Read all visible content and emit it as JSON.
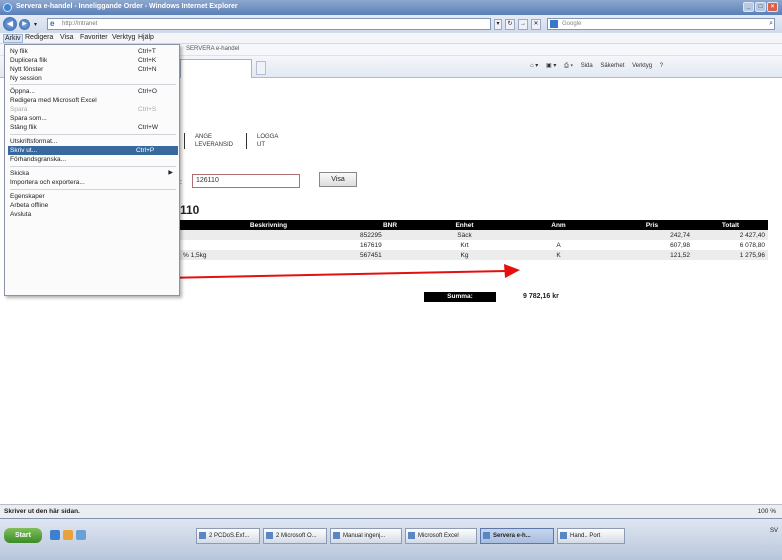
{
  "window": {
    "title": "Servera e-handel - Inneliggande Order - Windows Internet Explorer"
  },
  "address_bar": {
    "url": "http://Intranet",
    "search_placeholder": "Google"
  },
  "menu_bar": [
    "Arkiv",
    "Redigera",
    "Visa",
    "Favoriter",
    "Verktyg",
    "Hjälp"
  ],
  "favorites": {
    "item": "SERVERA e-handel"
  },
  "command_bar": [
    "Sida",
    "Säkerhet",
    "Verktyg"
  ],
  "file_menu": {
    "items": [
      {
        "label": "Ny flik",
        "shortcut": "Ctrl+T"
      },
      {
        "label": "Duplicera flik",
        "shortcut": "Ctrl+K"
      },
      {
        "label": "Nytt fönster",
        "shortcut": "Ctrl+N"
      },
      {
        "label": "Ny session",
        "shortcut": ""
      },
      {
        "label": "Öppna...",
        "shortcut": "Ctrl+O"
      },
      {
        "label": "Redigera med Microsoft Excel",
        "shortcut": ""
      },
      {
        "label": "Spara",
        "shortcut": "Ctrl+S"
      },
      {
        "label": "Spara som...",
        "shortcut": ""
      },
      {
        "label": "Stäng flik",
        "shortcut": "Ctrl+W"
      },
      {
        "label": "Utskriftsformat...",
        "shortcut": ""
      },
      {
        "label": "Skriv ut...",
        "shortcut": "Ctrl+P"
      },
      {
        "label": "Förhandsgranska...",
        "shortcut": ""
      },
      {
        "label": "Skicka",
        "shortcut": ""
      },
      {
        "label": "Importera och exportera...",
        "shortcut": ""
      },
      {
        "label": "Egenskaper",
        "shortcut": ""
      },
      {
        "label": "Arbeta offline",
        "shortcut": ""
      },
      {
        "label": "Avsluta",
        "shortcut": ""
      }
    ]
  },
  "page": {
    "nav_links": [
      "ANGE LEVERANSID",
      "LOGGA UT"
    ],
    "order_input_label": ":",
    "order_input_value": "126110",
    "show_button": "Visa",
    "order_number": "110",
    "table": {
      "headers": [
        "Beskrivning",
        "BNR",
        "Enhet",
        "Anm",
        "Pris",
        "Totalt"
      ],
      "rows": [
        {
          "desc": "",
          "bnr": "852295",
          "unit": "Säck",
          "note": "",
          "price": "242,74",
          "total": "2 427,40"
        },
        {
          "desc": "",
          "bnr": "167619",
          "unit": "Krt",
          "note": "A",
          "price": "607,98",
          "total": "6 078,80"
        },
        {
          "desc": "% 1,5kg",
          "bnr": "567451",
          "unit": "Kg",
          "note": "K",
          "price": "121,52",
          "total": "1 275,96"
        }
      ]
    },
    "sum_label": "Summa:",
    "sum_value": "9 782,16 kr"
  },
  "status_bar": {
    "text": "Skriver ut den här sidan.",
    "zoom": "100 %"
  },
  "taskbar": {
    "start": "Start",
    "items": [
      "2 PCDoS.Exf...",
      "2 Microsoft O...",
      "Manual ingenj...",
      "Microsoft Excel",
      "Servera e-h...",
      "Hand.. Port"
    ],
    "active_index": 4,
    "tray": "SV"
  },
  "colors": {
    "arrow": "#e41010",
    "menu_highlight": "#37689e"
  }
}
